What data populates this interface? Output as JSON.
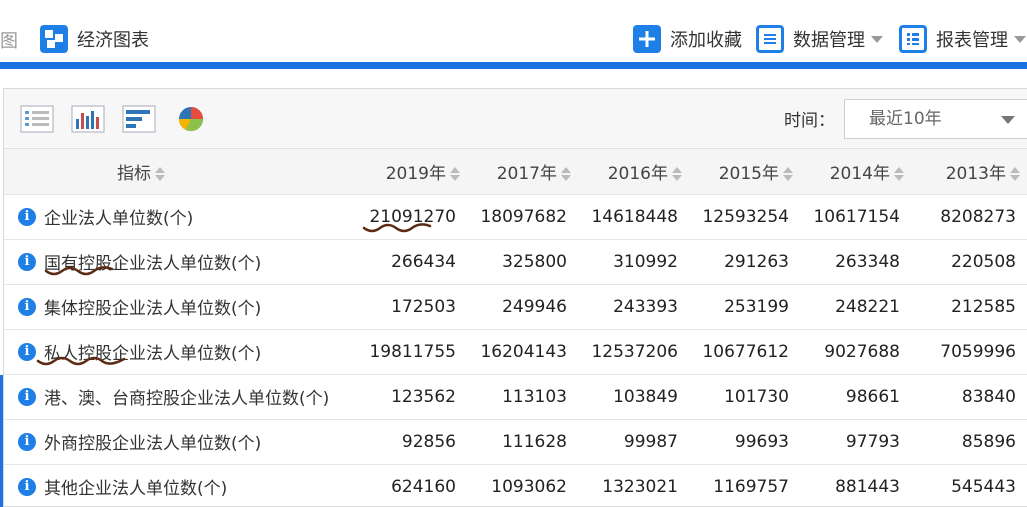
{
  "topnav": {
    "stub_text": "图",
    "economy_charts": "经济图表",
    "add_favorite": "添加收藏",
    "data_manage": "数据管理",
    "report_manage": "报表管理"
  },
  "toolbar": {
    "time_label": "时间：",
    "time_value": "最近10年",
    "icons": [
      "list-view-icon",
      "bar-chart-icon",
      "horizontal-bar-icon",
      "pie-chart-icon"
    ]
  },
  "table": {
    "headers": [
      "指标",
      "2019年",
      "2017年",
      "2016年",
      "2015年",
      "2014年",
      "2013年"
    ],
    "rows": [
      {
        "label": "企业法人单位数(个)",
        "values": [
          "21091270",
          "18097682",
          "14618448",
          "12593254",
          "10617154",
          "8208273"
        ]
      },
      {
        "label": "国有控股企业法人单位数(个)",
        "values": [
          "266434",
          "325800",
          "310992",
          "291263",
          "263348",
          "220508"
        ]
      },
      {
        "label": "集体控股企业法人单位数(个)",
        "values": [
          "172503",
          "249946",
          "243393",
          "253199",
          "248221",
          "212585"
        ]
      },
      {
        "label": "私人控股企业法人单位数(个)",
        "values": [
          "19811755",
          "16204143",
          "12537206",
          "10677612",
          "9027688",
          "7059996"
        ]
      },
      {
        "label": "港、澳、台商控股企业法人单位数(个)",
        "values": [
          "123562",
          "113103",
          "103849",
          "101730",
          "98661",
          "83840"
        ]
      },
      {
        "label": "外商控股企业法人单位数(个)",
        "values": [
          "92856",
          "111628",
          "99987",
          "99693",
          "97793",
          "85896"
        ]
      },
      {
        "label": "其他企业法人单位数(个)",
        "values": [
          "624160",
          "1093062",
          "1323021",
          "1169757",
          "881443",
          "545443"
        ]
      }
    ]
  },
  "colors": {
    "accent": "#1e7fe6",
    "ink": "#5a2a12"
  }
}
